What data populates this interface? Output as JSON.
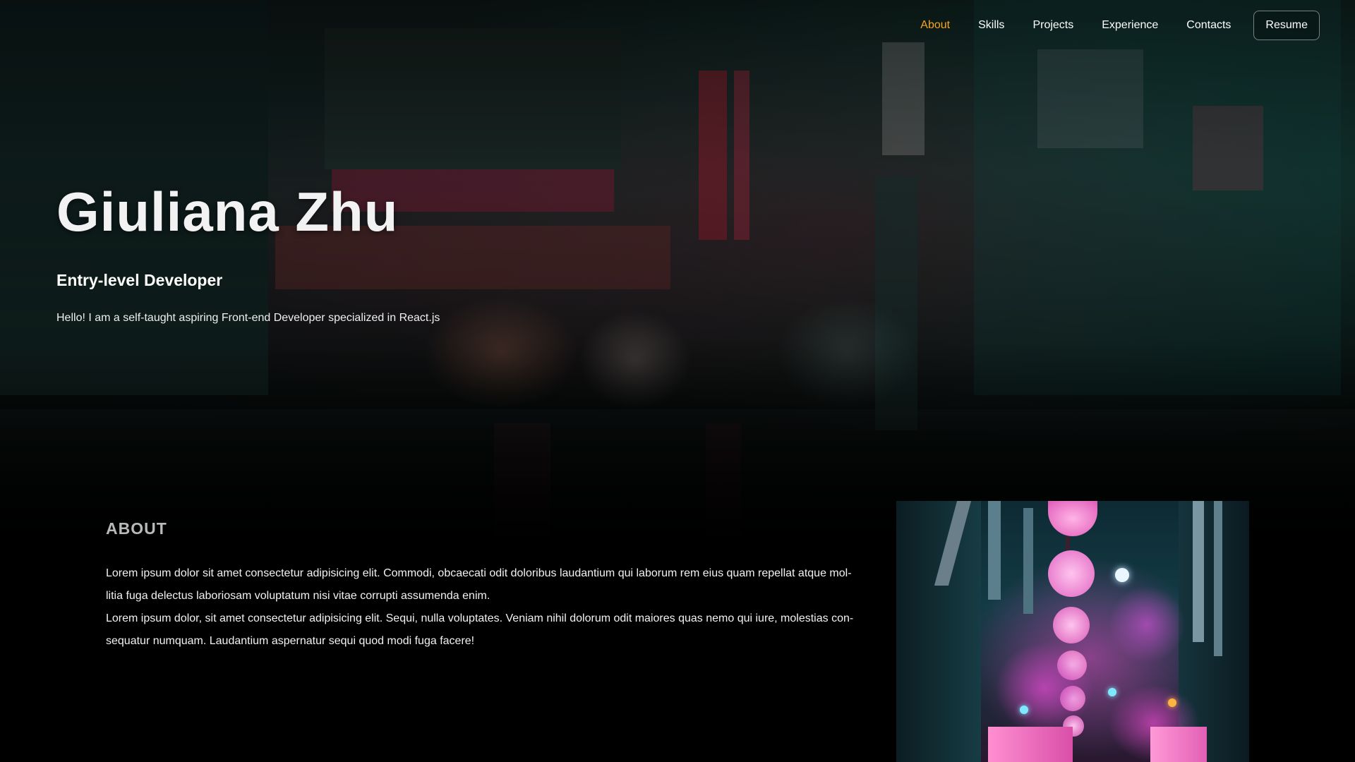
{
  "nav": {
    "items": [
      {
        "label": "About",
        "active": true
      },
      {
        "label": "Skills",
        "active": false
      },
      {
        "label": "Projects",
        "active": false
      },
      {
        "label": "Experience",
        "active": false
      },
      {
        "label": "Contacts",
        "active": false
      }
    ],
    "resume_label": "Resume"
  },
  "hero": {
    "name": "Giuliana Zhu",
    "role": "Entry-level Developer",
    "intro": "Hello! I am a self-taught aspiring Front-end Developer specialized in React.js"
  },
  "about": {
    "heading": "ABOUT",
    "paragraphs": [
      "Lorem ipsum dolor sit amet consectetur adipisicing elit. Commodi, obcaecati odit doloribus laudantium qui laborum rem eius quam repellat atque mol-litia fuga delectus laboriosam voluptatum nisi vitae corrupti assumenda enim.",
      "Lorem ipsum dolor, sit amet consectetur adipisicing elit. Sequi, nulla voluptates. Veniam nihil dolorum odit maiores quas nemo qui iure, molestias con-sequatur numquam. Laudantium aspernatur sequi quod modi fuga facere!"
    ]
  },
  "colors": {
    "accent": "#f5a623",
    "background": "#000000",
    "text": "#ffffff",
    "heading_muted": "#b9b9b9"
  }
}
